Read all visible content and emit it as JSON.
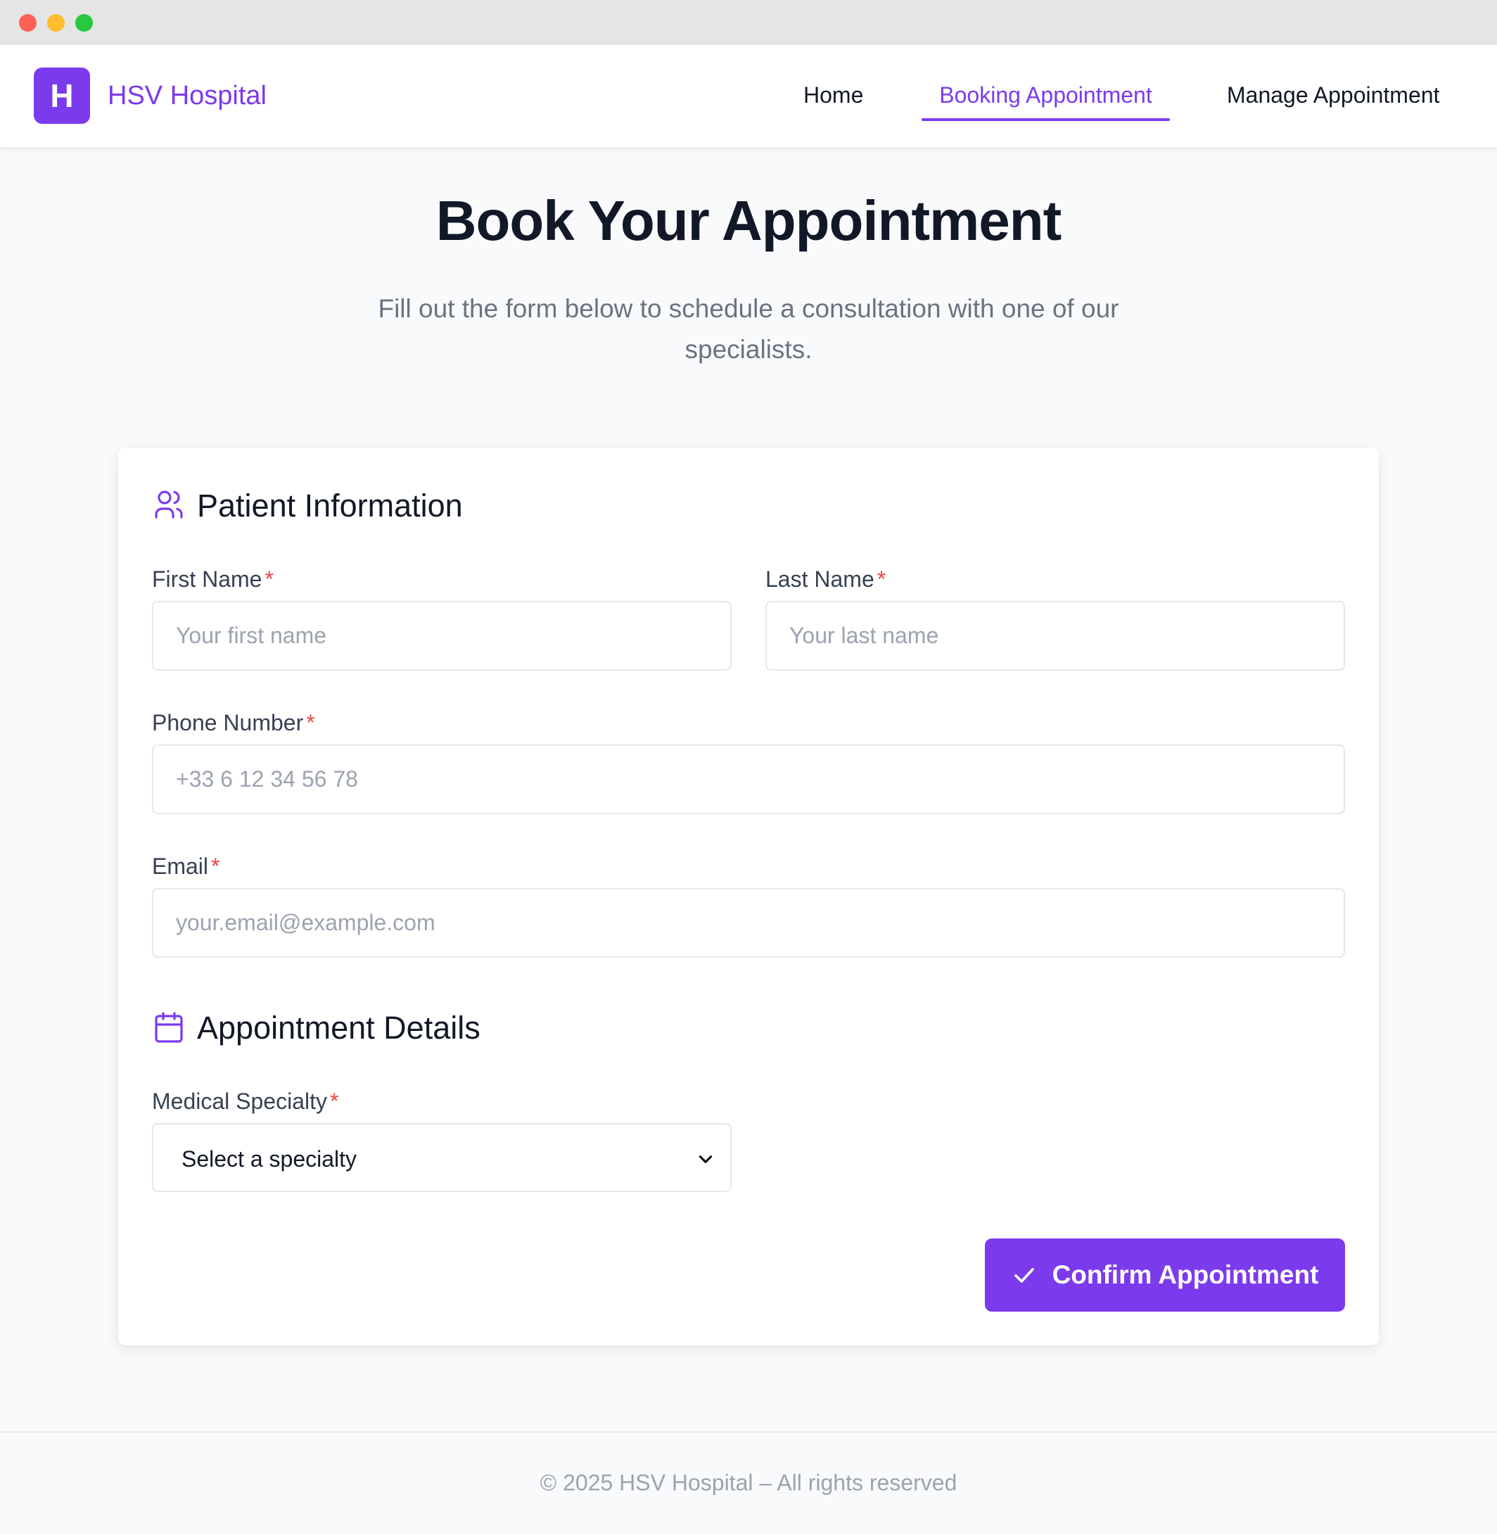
{
  "nav": {
    "logo_letter": "H",
    "brand": "HSV Hospital",
    "links": [
      {
        "label": "Home"
      },
      {
        "label": "Booking Appointment",
        "active": true
      },
      {
        "label": "Manage Appointment"
      }
    ]
  },
  "hero": {
    "title": "Book Your Appointment",
    "subtitle": "Fill out the form below to schedule a consultation with one of our specialists."
  },
  "patient_info": {
    "icon": "users-icon",
    "title": "Patient Information",
    "first_name": {
      "label": "First Name",
      "required": "*",
      "placeholder": "Your first name",
      "value": ""
    },
    "last_name": {
      "label": "Last Name",
      "required": "*",
      "placeholder": "Your last name",
      "value": ""
    },
    "phone": {
      "label": "Phone Number",
      "required": "*",
      "placeholder": "+33 6 12 34 56 78",
      "value": ""
    },
    "email": {
      "label": "Email",
      "required": "*",
      "placeholder": "your.email@example.com",
      "value": ""
    }
  },
  "appointment_details": {
    "icon": "calendar-icon",
    "title": "Appointment Details",
    "specialty": {
      "label": "Medical Specialty",
      "required": "*",
      "selected": "Select a specialty"
    }
  },
  "actions": {
    "confirm_label": "Confirm Appointment"
  },
  "footer": {
    "text": "© 2025 HSV Hospital – All rights reserved"
  },
  "colors": {
    "accent": "#7c3aed",
    "required": "#ef4444",
    "text": "#111827",
    "muted": "#6b7280"
  }
}
